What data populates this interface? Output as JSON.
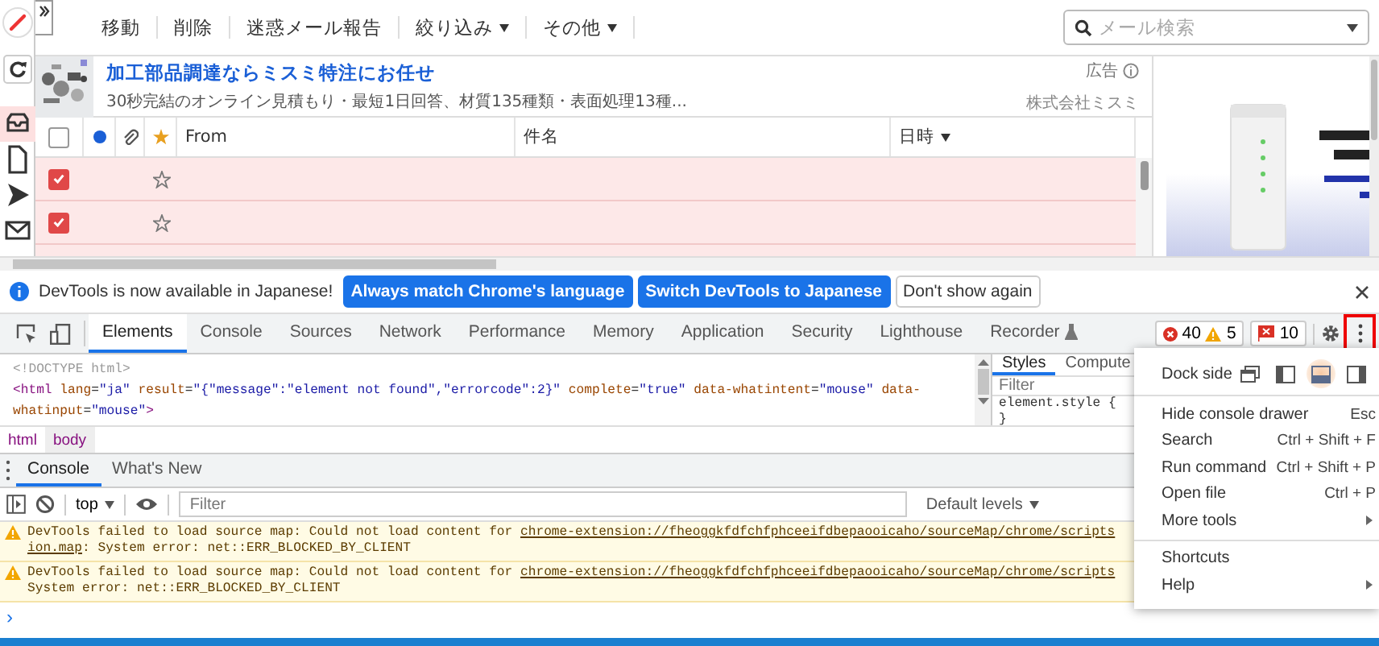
{
  "mail": {
    "toolbar": {
      "actions": [
        {
          "label": "移動",
          "dropdown": false
        },
        {
          "label": "削除",
          "dropdown": false
        },
        {
          "label": "迷惑メール報告",
          "dropdown": false
        },
        {
          "label": "絞り込み",
          "dropdown": true
        },
        {
          "label": "その他",
          "dropdown": true
        }
      ],
      "search": {
        "placeholder": "メール検索"
      }
    },
    "ad": {
      "title": "加工部品調達ならミスミ特注にお任せ",
      "description": "30秒完結のオンライン見積もり・最短1日回答、材質135種類・表面処理13種...",
      "label": "広告",
      "advertiser": "株式会社ミスミ"
    },
    "table": {
      "select_all": {
        "checked": false
      },
      "columns": [
        {
          "label": "From",
          "sorted": false
        },
        {
          "label": "件名",
          "sorted": false
        },
        {
          "label": "日時",
          "sorted": true
        }
      ],
      "rows": [
        {
          "checked": true,
          "starred": false
        },
        {
          "checked": true,
          "starred": false
        }
      ]
    }
  },
  "devtools": {
    "infobar": {
      "message": "DevTools is now available in Japanese!",
      "buttons": [
        {
          "label": "Always match Chrome's language",
          "kind": "primary"
        },
        {
          "label": "Switch DevTools to Japanese",
          "kind": "primary"
        },
        {
          "label": "Don't show again",
          "kind": "secondary"
        }
      ]
    },
    "tabs": [
      {
        "label": "Elements",
        "selected": true
      },
      {
        "label": "Console",
        "selected": false
      },
      {
        "label": "Sources",
        "selected": false
      },
      {
        "label": "Network",
        "selected": false
      },
      {
        "label": "Performance",
        "selected": false
      },
      {
        "label": "Memory",
        "selected": false
      },
      {
        "label": "Application",
        "selected": false
      },
      {
        "label": "Security",
        "selected": false
      },
      {
        "label": "Lighthouse",
        "selected": false
      },
      {
        "label": "Recorder",
        "selected": false
      }
    ],
    "counts": {
      "errors": "40",
      "warnings": "5",
      "issues": "10"
    },
    "more_button": {
      "highlighted": true
    },
    "elements": {
      "lines": [
        [
          {
            "kind": "doctype",
            "text": "<!DOCTYPE html>"
          }
        ],
        [
          {
            "kind": "tag",
            "text": "<html"
          },
          {
            "kind": "attr",
            "text": " lang"
          },
          {
            "kind": "punct",
            "text": "="
          },
          {
            "kind": "value",
            "text": "\"ja\""
          },
          {
            "kind": "attr",
            "text": " result"
          },
          {
            "kind": "punct",
            "text": "="
          },
          {
            "kind": "value",
            "text": "\"{\"message\":\"element not found\",\"errorcode\":2}\""
          },
          {
            "kind": "attr",
            "text": " complete"
          },
          {
            "kind": "punct",
            "text": "="
          },
          {
            "kind": "value",
            "text": "\"true\""
          },
          {
            "kind": "attr",
            "text": " data-whatintent"
          },
          {
            "kind": "punct",
            "text": "="
          },
          {
            "kind": "value",
            "text": "\"mouse\""
          },
          {
            "kind": "attr",
            "text": " data-"
          }
        ],
        [
          {
            "kind": "attr",
            "text": "whatinput"
          },
          {
            "kind": "punct",
            "text": "="
          },
          {
            "kind": "value",
            "text": "\"mouse\""
          },
          {
            "kind": "tag",
            "text": ">"
          }
        ]
      ]
    },
    "breadcrumbs": [
      {
        "label": "html",
        "selected": false
      },
      {
        "label": "body",
        "selected": true
      }
    ],
    "styles": {
      "tabs": [
        {
          "label": "Styles",
          "selected": true
        },
        {
          "label": "Compute",
          "selected": false
        }
      ],
      "filter": {
        "placeholder": "Filter"
      },
      "rules": [
        "element.style {",
        "}"
      ]
    },
    "drawer": {
      "tabs": [
        {
          "label": "Console",
          "selected": true
        },
        {
          "label": "What's New",
          "selected": false
        }
      ],
      "context": "top",
      "filter": {
        "placeholder": "Filter"
      },
      "levels": "Default levels",
      "messages": [
        {
          "kind": "warning",
          "lines": [
            [
              {
                "text": "DevTools failed to load source map: Could not load content for ",
                "link": false
              },
              {
                "text": "chrome-extension://fheoggkfdfchfphceeifdbepaooicaho/sourceMap/chrome/scripts",
                "link": true
              }
            ],
            [
              {
                "text": "ion.map",
                "link": true
              },
              {
                "text": ": System error: net::ERR_BLOCKED_BY_CLIENT",
                "link": false
              }
            ]
          ]
        },
        {
          "kind": "warning",
          "lines": [
            [
              {
                "text": "DevTools failed to load source map: Could not load content for ",
                "link": false
              },
              {
                "text": "chrome-extension://fheoggkfdfchfphceeifdbepaooicaho/sourceMap/chrome/scripts",
                "link": true
              }
            ],
            [
              {
                "text": "System error: net::ERR_BLOCKED_BY_CLIENT",
                "link": false
              }
            ]
          ]
        }
      ],
      "prompt": "›"
    },
    "menu": {
      "dock_side": {
        "label": "Dock side",
        "options": [
          {
            "kind": "undock",
            "selected": false
          },
          {
            "kind": "left",
            "selected": false
          },
          {
            "kind": "bottom",
            "selected": true
          },
          {
            "kind": "right",
            "selected": false
          }
        ]
      },
      "groups": [
        [
          {
            "label": "Hide console drawer",
            "shortcut": "Esc",
            "submenu": false
          },
          {
            "label": "Search",
            "shortcut": "Ctrl + Shift + F",
            "submenu": false
          },
          {
            "label": "Run command",
            "shortcut": "Ctrl + Shift + P",
            "submenu": false
          },
          {
            "label": "Open file",
            "shortcut": "Ctrl + P",
            "submenu": false
          },
          {
            "label": "More tools",
            "submenu": true
          }
        ],
        [
          {
            "label": "Shortcuts",
            "submenu": false
          },
          {
            "label": "Help",
            "submenu": true
          }
        ]
      ]
    }
  }
}
